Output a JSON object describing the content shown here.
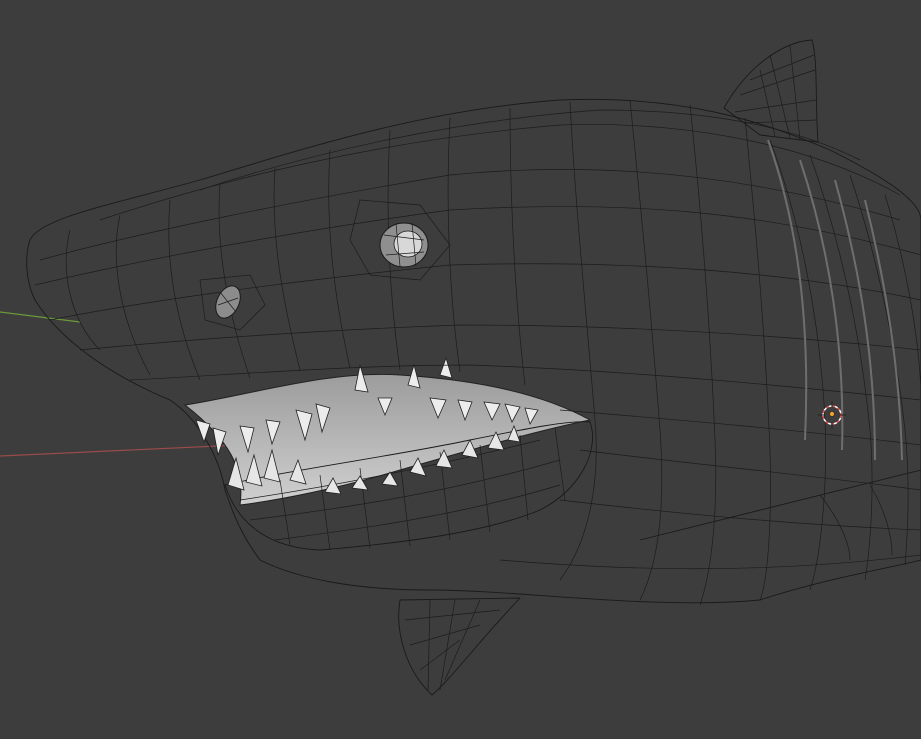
{
  "viewport": {
    "background_color": "#3d3d3d",
    "mesh_base_color": "#a9a9a9",
    "mesh_highlight_color": "#d8d8d8",
    "wire_color": "#1a1a1a",
    "x_axis_color": "#9a4b4b",
    "y_axis_color": "#6a9a3a",
    "cursor_colors": [
      "#e25555",
      "#ffffff"
    ],
    "origin_color": "#f0a030"
  },
  "scene": {
    "object": "shark-mesh",
    "shading": "solid",
    "overlay": "wireframe",
    "icons": [
      "3d-cursor-icon",
      "object-origin-icon"
    ]
  }
}
